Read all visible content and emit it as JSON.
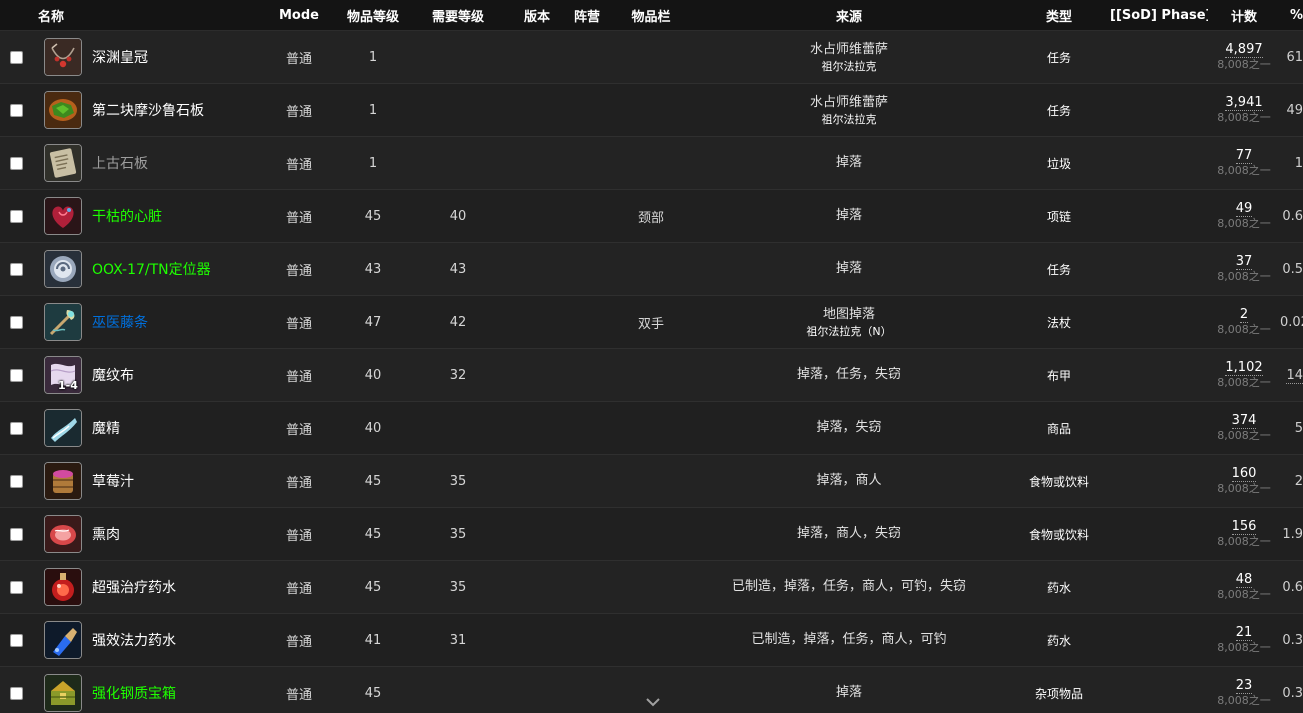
{
  "header": {
    "name": "名称",
    "mode": "Mode",
    "item_level": "物品等级",
    "req_level": "需要等级",
    "version": "版本",
    "side": "阵营",
    "slot": "物品栏",
    "source": "来源",
    "type": "类型",
    "sod_phase": "[[SoD] Phase]",
    "count": "计数",
    "percent": "%"
  },
  "rows": [
    {
      "name": "深渊皇冠",
      "quality": "common",
      "icon": "necklace-icon",
      "mode": "普通",
      "ilvl": "1",
      "req": "",
      "slot": "",
      "source": "水占师维蕾萨",
      "source_sub": "祖尔法拉克",
      "type": "任务",
      "count": "4,897",
      "count_sub": "8,008之一",
      "pct": "61",
      "pct_dotted": false
    },
    {
      "name": "第二块摩沙鲁石板",
      "quality": "common",
      "icon": "green-stone-tablet-icon",
      "mode": "普通",
      "ilvl": "1",
      "req": "",
      "slot": "",
      "source": "水占师维蕾萨",
      "source_sub": "祖尔法拉克",
      "type": "任务",
      "count": "3,941",
      "count_sub": "8,008之一",
      "pct": "49",
      "pct_dotted": false
    },
    {
      "name": "上古石板",
      "quality": "poor",
      "icon": "stone-tablet-icon",
      "mode": "普通",
      "ilvl": "1",
      "req": "",
      "slot": "",
      "source": "掉落",
      "source_sub": "",
      "type": "垃圾",
      "count": "77",
      "count_sub": "8,008之一",
      "pct": "1",
      "pct_dotted": false
    },
    {
      "name": "干枯的心脏",
      "quality": "uncommon",
      "icon": "heart-icon",
      "mode": "普通",
      "ilvl": "45",
      "req": "40",
      "slot": "颈部",
      "source": "掉落",
      "source_sub": "",
      "type": "项链",
      "count": "49",
      "count_sub": "8,008之一",
      "pct": "0.6",
      "pct_dotted": false
    },
    {
      "name": "OOX-17/TN定位器",
      "quality": "uncommon",
      "icon": "locator-device-icon",
      "mode": "普通",
      "ilvl": "43",
      "req": "43",
      "slot": "",
      "source": "掉落",
      "source_sub": "",
      "type": "任务",
      "count": "37",
      "count_sub": "8,008之一",
      "pct": "0.5",
      "pct_dotted": false
    },
    {
      "name": "巫医藤条",
      "quality": "rare",
      "icon": "staff-icon",
      "mode": "普通",
      "ilvl": "47",
      "req": "42",
      "slot": "双手",
      "source": "地图掉落",
      "source_sub": "祖尔法拉克（N）",
      "type": "法杖",
      "count": "2",
      "count_sub": "8,008之一",
      "pct": "0.02",
      "pct_dotted": false
    },
    {
      "name": "魔纹布",
      "quality": "common",
      "icon": "cloth-icon",
      "stack": "1-4",
      "mode": "普通",
      "ilvl": "40",
      "req": "32",
      "slot": "",
      "source": "掉落，任务，失窃",
      "source_sub": "",
      "type": "布甲",
      "count": "1,102",
      "count_sub": "8,008之一",
      "pct": "14",
      "pct_dotted": true
    },
    {
      "name": "魔精",
      "quality": "common",
      "icon": "flask-icon",
      "mode": "普通",
      "ilvl": "40",
      "req": "",
      "slot": "",
      "source": "掉落，失窃",
      "source_sub": "",
      "type": "商品",
      "count": "374",
      "count_sub": "8,008之一",
      "pct": "5",
      "pct_dotted": false
    },
    {
      "name": "草莓汁",
      "quality": "common",
      "icon": "juice-barrel-icon",
      "mode": "普通",
      "ilvl": "45",
      "req": "35",
      "slot": "",
      "source": "掉落，商人",
      "source_sub": "",
      "type": "食物或饮料",
      "count": "160",
      "count_sub": "8,008之一",
      "pct": "2",
      "pct_dotted": false
    },
    {
      "name": "熏肉",
      "quality": "common",
      "icon": "meat-icon",
      "mode": "普通",
      "ilvl": "45",
      "req": "35",
      "slot": "",
      "source": "掉落，商人，失窃",
      "source_sub": "",
      "type": "食物或饮料",
      "count": "156",
      "count_sub": "8,008之一",
      "pct": "1.9",
      "pct_dotted": false
    },
    {
      "name": "超强治疗药水",
      "quality": "common",
      "icon": "red-potion-icon",
      "mode": "普通",
      "ilvl": "45",
      "req": "35",
      "slot": "",
      "source": "已制造，掉落，任务，商人，可钓，失窃",
      "source_sub": "",
      "type": "药水",
      "count": "48",
      "count_sub": "8,008之一",
      "pct": "0.6",
      "pct_dotted": false
    },
    {
      "name": "强效法力药水",
      "quality": "common",
      "icon": "blue-potion-icon",
      "mode": "普通",
      "ilvl": "41",
      "req": "31",
      "slot": "",
      "source": "已制造，掉落，任务，商人，可钓",
      "source_sub": "",
      "type": "药水",
      "count": "21",
      "count_sub": "8,008之一",
      "pct": "0.3",
      "pct_dotted": false
    },
    {
      "name": "强化钢质宝箱",
      "quality": "uncommon",
      "icon": "treasure-chest-icon",
      "mode": "普通",
      "ilvl": "45",
      "req": "",
      "slot": "",
      "source": "掉落",
      "source_sub": "",
      "type": "杂项物品",
      "count": "23",
      "count_sub": "8,008之一",
      "pct": "0.3",
      "pct_dotted": false
    }
  ]
}
